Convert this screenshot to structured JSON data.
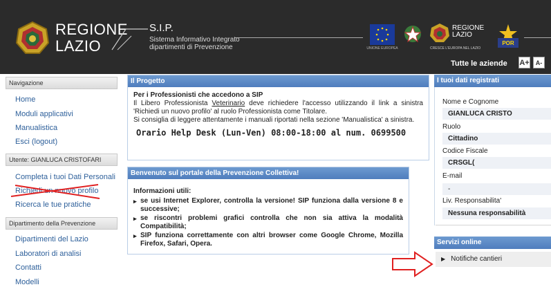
{
  "header": {
    "regione_line1": "REGIONE",
    "regione_line2": "LAZIO",
    "sip_title": "S.I.P.",
    "sip_sub_line1": "Sistema Informativo Integrato",
    "sip_sub_line2": "dipartimenti di Prevenzione",
    "eu_caption": "UNIONE EUROPEA",
    "rl_small_line1": "REGIONE",
    "rl_small_line2": "LAZIO",
    "rl_caption": "CRESCE L'EUROPA NEL LAZIO",
    "por_label": "POR",
    "aziende_label": "Tutte le aziende",
    "font_big": "A+",
    "font_small": "A-"
  },
  "nav": {
    "section1_title": "Navigazione",
    "section1_items": [
      "Home",
      "Moduli applicativi",
      "Manualistica",
      "Esci (logout)"
    ],
    "section2_title": "Utente: GIANLUCA CRISTOFARI",
    "section2_items": [
      "Completa i tuoi Dati Personali",
      "Richiedi un nuovo profilo",
      "Ricerca le tue pratiche"
    ],
    "section3_title": "Dipartimento della Prevenzione",
    "section3_items": [
      "Dipartimenti del Lazio",
      "Laboratori di analisi",
      "Contatti",
      "Modelli"
    ]
  },
  "progetto": {
    "title": "Il Progetto",
    "heading": "Per i Professionisti che accedono a SIP",
    "p1_a": "Il Libero Professionista ",
    "p1_link": "Veterinario",
    "p1_b": " deve richiedere l'accesso utilizzando il link a sinistra 'Richiedi un nuovo profilo' al ruolo Professionista come Titolare.",
    "p2": "Si consiglia di leggere attentamente i manuali riportati nella sezione 'Manualistica' a sinistra.",
    "helpdesk": "Orario Help Desk (Lun-Ven) 08:00-18:00 al num. 0699500"
  },
  "benvenuto": {
    "title": "Benvenuto sul portale della Prevenzione Collettiva!",
    "info_heading": "Informazioni utili:",
    "items": [
      "se usi Internet Explorer, controlla la versione! SIP funziona dalla versione 8 e successive;",
      "se riscontri problemi grafici controlla che non sia attiva la modalità Compatibilità;",
      "SIP funziona correttamente con altri browser come Google Chrome, Mozilla Firefox, Safari, Opera."
    ]
  },
  "dati": {
    "title": "I tuoi dati registrati",
    "nome_label": "Nome e Cognome",
    "nome_value": "GIANLUCA CRISTO",
    "ruolo_label": "Ruolo",
    "ruolo_value": "Cittadino",
    "cf_label": "Codice Fiscale",
    "cf_value": "CRSGL(",
    "email_label": "E-mail",
    "email_value": "-",
    "resp_label": "Liv. Responsabilita'",
    "resp_value": "Nessuna responsabilità"
  },
  "servizi": {
    "title": "Servizi online",
    "item": "Notifiche cantieri"
  },
  "colors": {
    "panel_header": "#5b87c5",
    "link": "#2d5f9a",
    "annotation_red": "#e02020"
  }
}
